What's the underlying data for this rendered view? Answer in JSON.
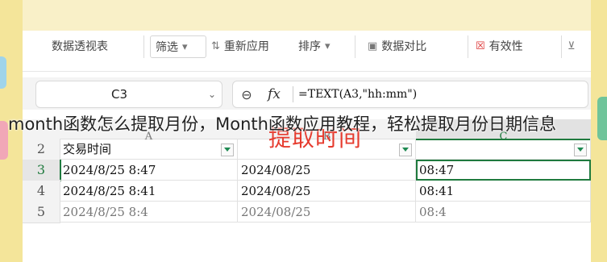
{
  "ribbon": {
    "items": [
      {
        "label": "数据透视表",
        "icon": "pivot-table-icon"
      },
      {
        "label": "筛选",
        "icon": "chevron-down-icon"
      },
      {
        "label": "重新应用",
        "icon": "refresh-icon"
      },
      {
        "label": "排序",
        "icon": "chevron-down-icon"
      },
      {
        "label": "数据对比",
        "icon": "compare-icon"
      },
      {
        "label": "有效性",
        "icon": "validation-icon"
      }
    ]
  },
  "formula_bar": {
    "name_box": "C3",
    "formula": "=TEXT(A3,\"hh:mm\")"
  },
  "columns": [
    "A",
    "B",
    "C"
  ],
  "rows": [
    {
      "num": "2",
      "cells": [
        "交易时间",
        "",
        ""
      ]
    },
    {
      "num": "3",
      "cells": [
        "2024/8/25  8:47",
        "2024/08/25",
        "08:47"
      ]
    },
    {
      "num": "4",
      "cells": [
        "2024/8/25  8:41",
        "2024/08/25",
        "08:41"
      ]
    },
    {
      "num": "5",
      "cells": [
        "2024/8/25  8:4",
        "2024/08/25",
        "08:4"
      ]
    }
  ],
  "overlay_label": "提取时间",
  "caption": "month函数怎么提取月份，Month函数应用教程，轻松提取月份日期信息",
  "colors": {
    "accent": "#1f7a3e",
    "overlay": "#e63b2e"
  }
}
